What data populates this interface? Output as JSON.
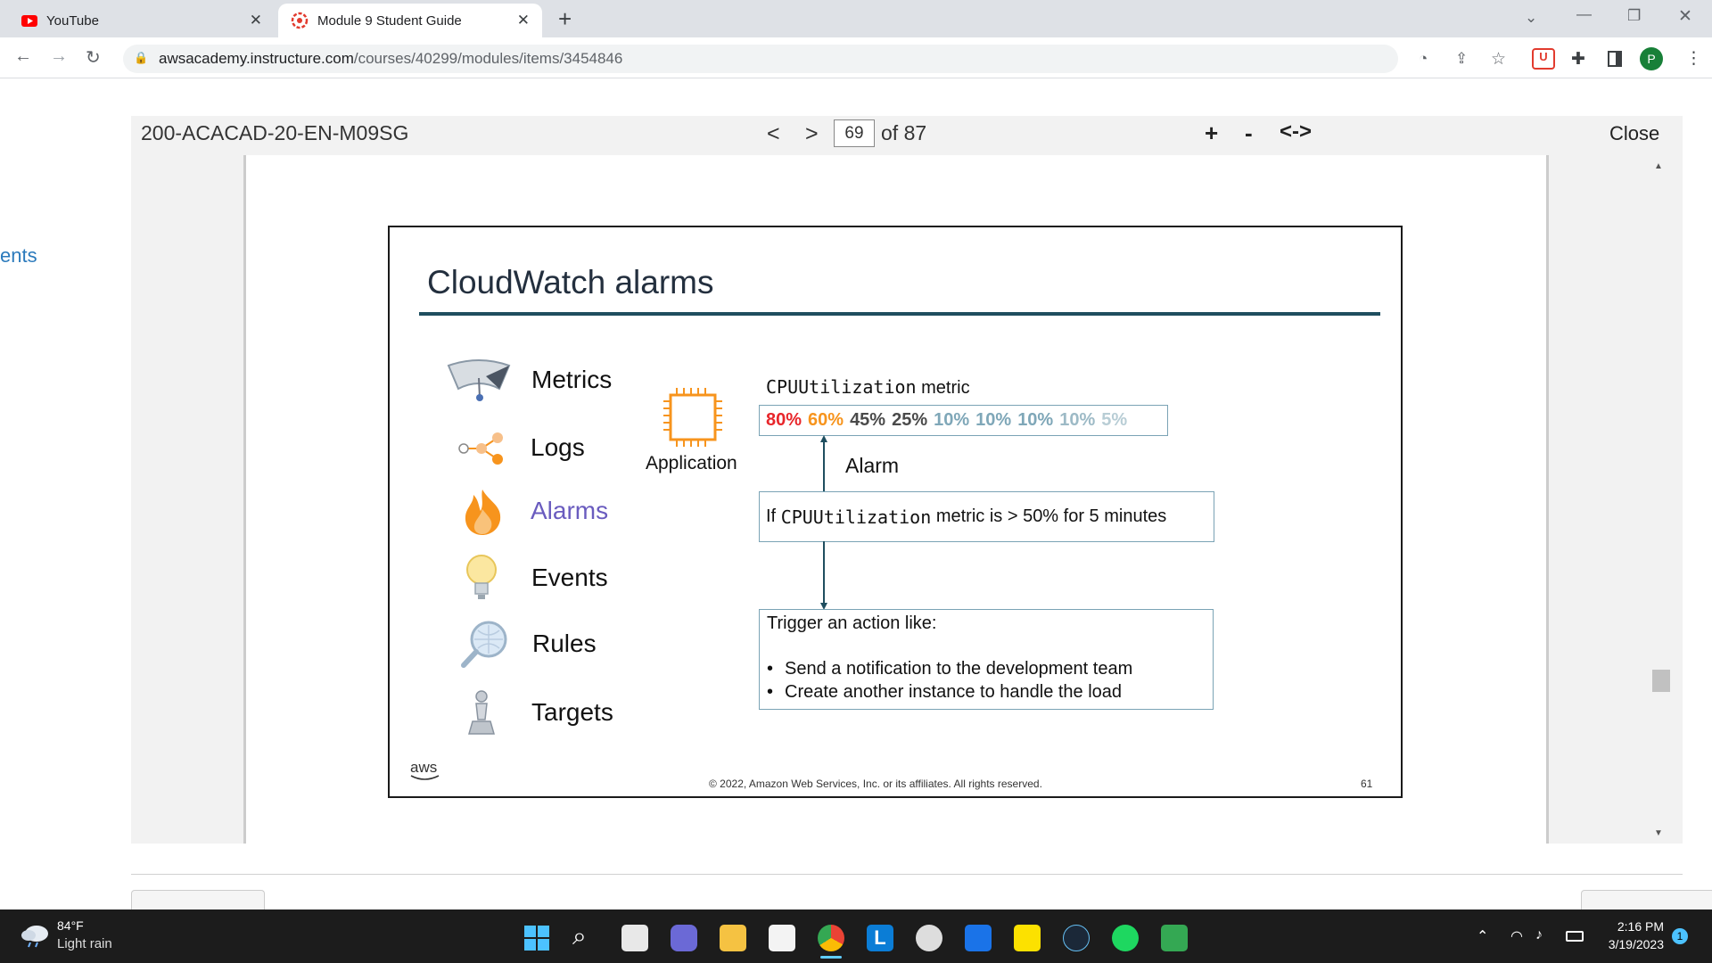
{
  "browser": {
    "tabs": [
      {
        "title": "YouTube",
        "active": false
      },
      {
        "title": "Module 9 Student Guide",
        "active": true
      }
    ],
    "new_tab": "+",
    "url_host": "awsacademy.instructure.com",
    "url_path": "/courses/40299/modules/items/3454846",
    "profile_initial": "P"
  },
  "viewer": {
    "doc_title": "200-ACACAD-20-EN-M09SG",
    "prev": "<",
    "next": ">",
    "page_current": "69",
    "page_of": "of 87",
    "zoom_in": "+",
    "zoom_out": "-",
    "fit": "<->",
    "close": "Close",
    "left_link": "ents"
  },
  "slide": {
    "title": "CloudWatch alarms",
    "services": [
      "Metrics",
      "Logs",
      "Alarms",
      "Events",
      "Rules",
      "Targets"
    ],
    "highlighted_service": "Alarms",
    "app_label": "Application",
    "metric_name": "CPUUtilization",
    "metric_suffix": "metric",
    "metric_values": [
      {
        "v": "80%",
        "color": "#e8262b"
      },
      {
        "v": "60%",
        "color": "#f7941d"
      },
      {
        "v": "45%",
        "color": "#4a4a4a"
      },
      {
        "v": "25%",
        "color": "#4a4a4a"
      },
      {
        "v": "10%",
        "color": "#7fa7b8"
      },
      {
        "v": "10%",
        "color": "#7fa7b8"
      },
      {
        "v": "10%",
        "color": "#7fa7b8"
      },
      {
        "v": "10%",
        "color": "#9dbac6"
      },
      {
        "v": "5%",
        "color": "#b8cdd5"
      }
    ],
    "alarm_label": "Alarm",
    "cond_prefix": "If",
    "cond_metric": "CPUUtilization",
    "cond_suffix": "metric is > 50% for 5 minutes",
    "trigger_head": "Trigger an action like:",
    "trigger_items": [
      "Send a notification to the development team",
      "Create another instance to handle the load"
    ],
    "footer": "© 2022, Amazon Web Services, Inc. or its affiliates. All rights reserved.",
    "page_number": "61",
    "logo_text": "aws"
  },
  "taskbar": {
    "temperature": "84°F",
    "weather": "Light rain",
    "time": "2:16 PM",
    "date": "3/19/2023",
    "notification_count": "1"
  }
}
